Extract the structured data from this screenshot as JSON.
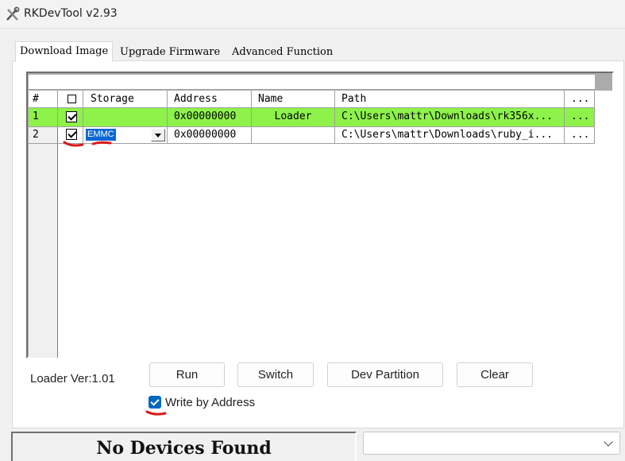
{
  "window": {
    "title": "RKDevTool v2.93"
  },
  "tabs": [
    {
      "label": "Download Image",
      "active": true
    },
    {
      "label": "Upgrade Firmware",
      "active": false
    },
    {
      "label": "Advanced Function",
      "active": false
    }
  ],
  "grid": {
    "columns": [
      "#",
      "",
      "Storage",
      "Address",
      "Name",
      "Path",
      "..."
    ],
    "rows": [
      {
        "index": "1",
        "checked": true,
        "storage": "",
        "address": "0x00000000",
        "name": "Loader",
        "path": "C:\\Users\\mattr\\Downloads\\rk356x...",
        "browse": "...",
        "row_color": "#8ef24a"
      },
      {
        "index": "2",
        "checked": true,
        "storage": "EMMC",
        "address": "0x00000000",
        "name": "",
        "path": "C:\\Users\\mattr\\Downloads\\ruby_i...",
        "browse": "..."
      }
    ]
  },
  "loader_version": "Loader Ver:1.01",
  "buttons": {
    "run": "Run",
    "switch": "Switch",
    "dev_partition": "Dev Partition",
    "clear": "Clear"
  },
  "write_by_address": {
    "label": "Write by Address",
    "checked": true
  },
  "status": {
    "text": "No Devices Found"
  },
  "device_select": {
    "value": ""
  },
  "colors": {
    "loader_row": "#8ef24a",
    "selection": "#0a66d6",
    "checkbox_accent": "#0067c0",
    "annotation": "#d9191b"
  }
}
